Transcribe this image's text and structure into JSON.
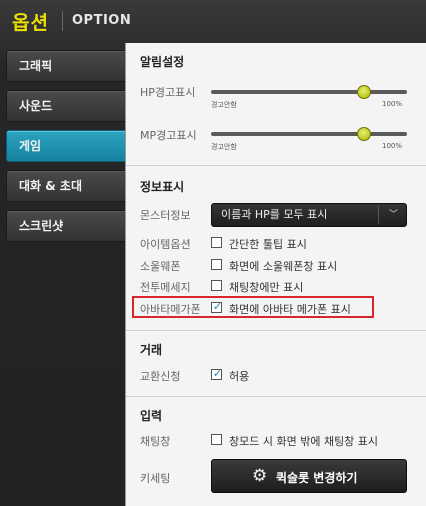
{
  "window": {
    "title_kr": "옵션",
    "title_en": "OPTION"
  },
  "sidebar": {
    "items": [
      {
        "label": "그래픽",
        "active": false
      },
      {
        "label": "사운드",
        "active": false
      },
      {
        "label": "게임",
        "active": true
      },
      {
        "label": "대화 & 초대",
        "active": false
      },
      {
        "label": "스크린샷",
        "active": false
      }
    ]
  },
  "alarm": {
    "title": "알림설정",
    "hp": {
      "label": "HP경고표시",
      "min_label": "경고안함",
      "max_label": "100%",
      "value_percent": 78
    },
    "mp": {
      "label": "MP경고표시",
      "min_label": "경고안함",
      "max_label": "100%",
      "value_percent": 78
    }
  },
  "info": {
    "title": "정보표시",
    "monster": {
      "label": "몬스터정보",
      "selected": "이름과 HP를 모두 표시"
    },
    "item_option": {
      "label": "아이템옵션",
      "text": "간단한 툴팁 표시",
      "checked": false
    },
    "soul_weapon": {
      "label": "소울웨폰",
      "text": "화면에 소울웨폰창 표시",
      "checked": false
    },
    "battle_msg": {
      "label": "전투메세지",
      "text": "채팅창에만 표시",
      "checked": false
    },
    "avatar_megaphone": {
      "label": "아바타메가폰",
      "text": "화면에 아바타 메가폰 표시",
      "checked": true
    }
  },
  "trade": {
    "title": "거래",
    "request": {
      "label": "교환신청",
      "text": "허용",
      "checked": true
    }
  },
  "input": {
    "title": "입력",
    "chat": {
      "label": "채팅창",
      "text": "창모드 시 화면 밖에 채팅창 표시",
      "checked": false
    },
    "keyset": {
      "label": "키세팅",
      "button_label": "퀵슬롯 변경하기"
    }
  },
  "colors": {
    "title_accent": "#f0e000",
    "active_tab": "#1d8aab",
    "highlight_border": "#d8262a",
    "slider_knob": "#c8d400"
  }
}
